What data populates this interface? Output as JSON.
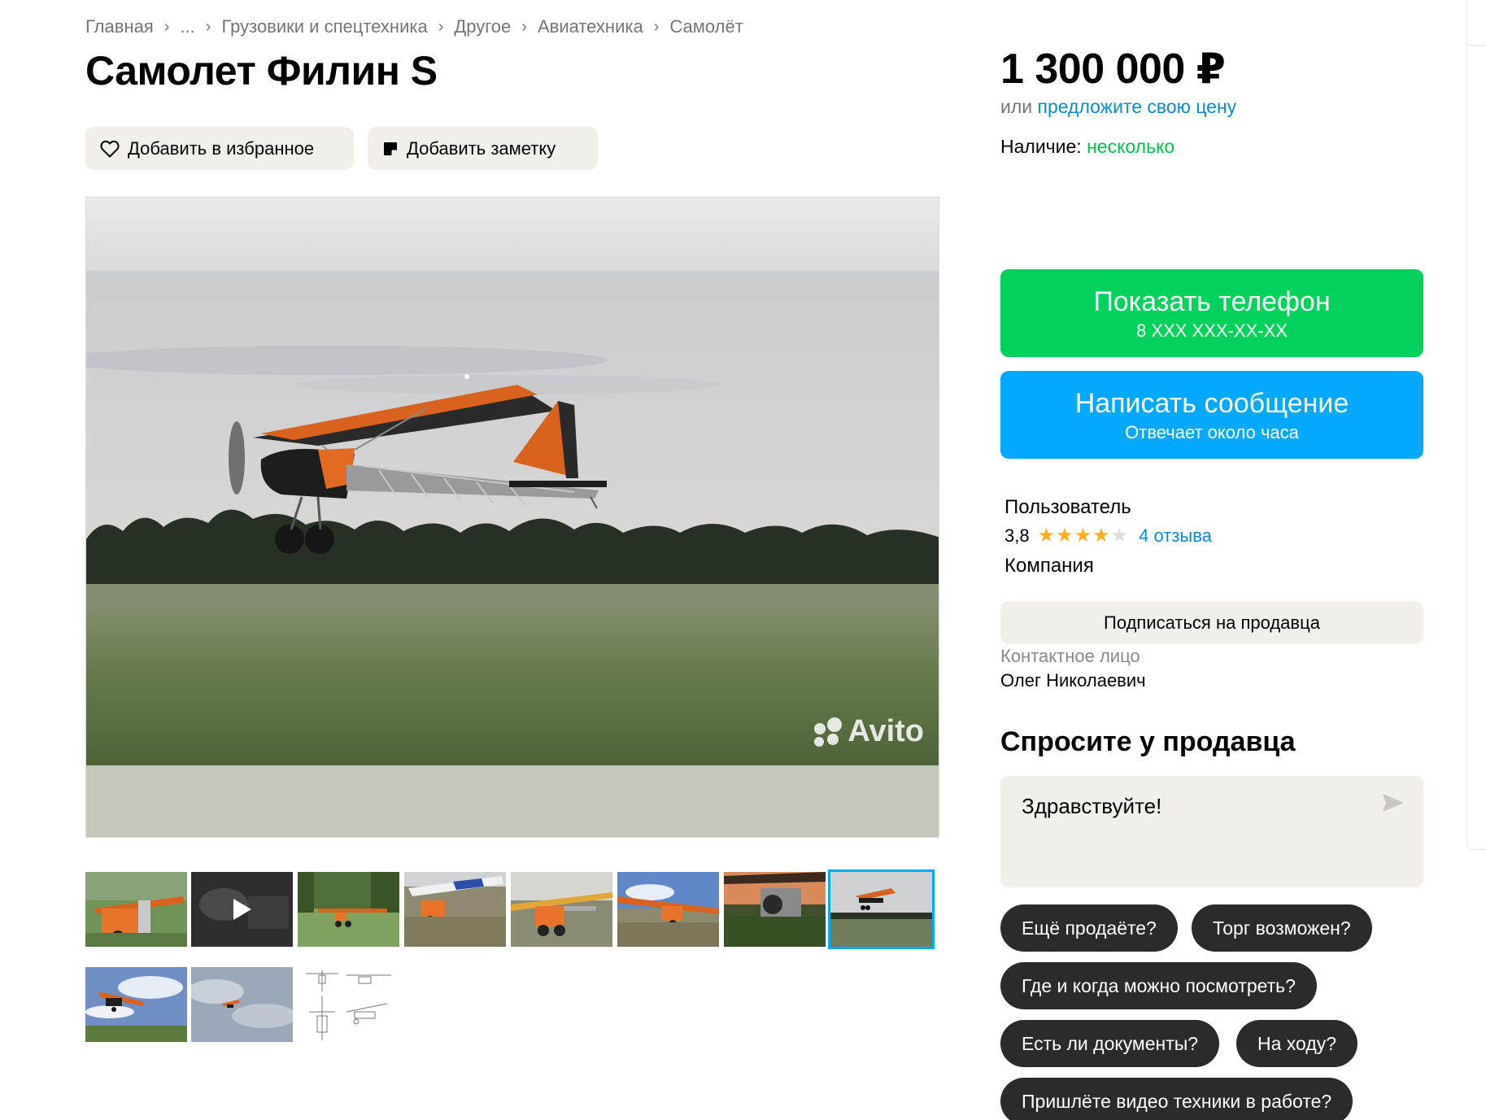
{
  "breadcrumb": {
    "items": [
      "Главная",
      "...",
      "Грузовики и спецтехника",
      "Другое",
      "Авиатехника",
      "Самолёт"
    ],
    "separator": "›"
  },
  "listing": {
    "title": "Самолет Филин S",
    "favorite_label": "Добавить в избранное",
    "note_label": "Добавить заметку",
    "watermark": "Avito"
  },
  "price": {
    "amount": "1 300 000 ₽",
    "offer_prefix": "или",
    "offer_link": "предложите свою цену",
    "availability_label": "Наличие:",
    "availability_value": "несколько"
  },
  "contact": {
    "phone_button": "Показать телефон",
    "phone_masked": "8 XXX XXX-XX-XX",
    "message_button": "Написать сообщение",
    "message_sub": "Отвечает около часа"
  },
  "seller": {
    "name": "Пользователь",
    "rating": "3,8",
    "rating_value": 3.8,
    "stars_filled": 4,
    "stars_total": 5,
    "reviews": "4 отзыва",
    "type": "Компания",
    "subscribe_label": "Подписаться на продавца",
    "contact_label": "Контактное лицо",
    "contact_name": "Олег Николаевич"
  },
  "ask": {
    "title": "Спросите у продавца",
    "message_value": "Здравствуйте!",
    "chips": [
      "Ещё продаёте?",
      "Торг возможен?",
      "Где и когда можно посмотреть?",
      "Есть ли документы?",
      "На ходу?",
      "Пришлёте видео техники в работе?"
    ]
  },
  "gallery": {
    "active_index": 7,
    "thumbnails": [
      "photo",
      "video",
      "photo",
      "photo",
      "photo",
      "photo",
      "photo",
      "photo",
      "photo",
      "photo",
      "drawing"
    ]
  },
  "colors": {
    "green": "#02d15c",
    "blue": "#04a8ff",
    "link": "#0a8bd6",
    "availability": "#02c44e",
    "star": "#ffb021",
    "chip_bg": "#2b2b2b",
    "secondary_bg": "#f2efea"
  }
}
